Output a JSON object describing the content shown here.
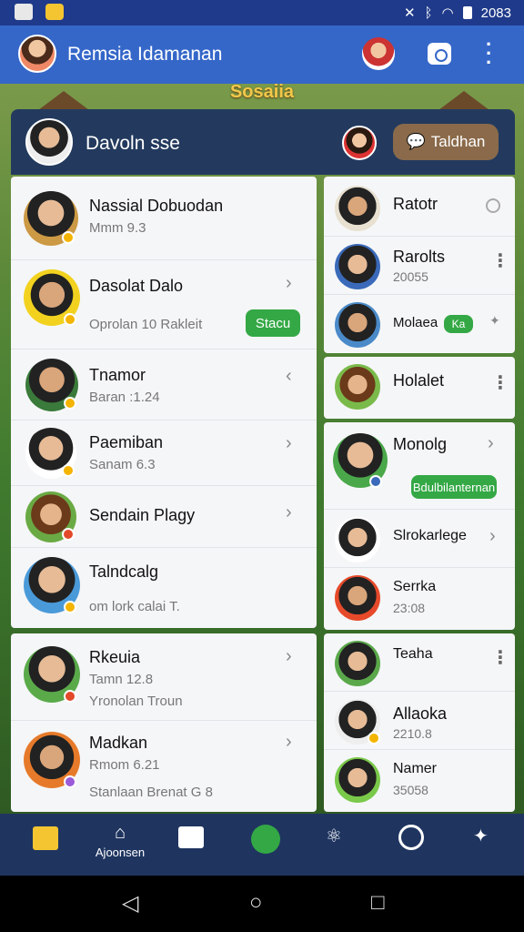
{
  "status_bar": {
    "time": "2083"
  },
  "app_bar": {
    "title": "Remsia Idamanan"
  },
  "background": {
    "title": "Sosaiia"
  },
  "panel": {
    "title": "Davoln sse",
    "action_button": "Taldhan"
  },
  "left_list": [
    {
      "name": "Nassial Dobuodan",
      "sub": "Mmm 9.3"
    },
    {
      "name": "Dasolat Dalo",
      "sub": "Oprolan 10 Rakleit",
      "action": "Stacu"
    },
    {
      "name": "Tnamor",
      "sub": "Baran :1.24"
    },
    {
      "name": "Paemiban",
      "sub": "Sanam 6.3"
    },
    {
      "name": "Sendain Plagy",
      "sub": ""
    },
    {
      "name": "Talndcalg",
      "sub": "om  lork   calai  T."
    },
    {
      "name": "Rkeuia",
      "sub": "Tamn 12.8",
      "sub2": "Yronolan Troun"
    },
    {
      "name": "Madkan",
      "sub": "Rmom 6.21",
      "sub2": "Stanlaan Brenat  G 8"
    }
  ],
  "right_list": [
    {
      "name": "Ratotr",
      "sub": ""
    },
    {
      "name": "Rarolts",
      "sub": "20055"
    },
    {
      "name": "Molaea",
      "sub": "",
      "tag": "Ka"
    },
    {
      "name": "Holalet",
      "sub": ""
    },
    {
      "name": "Monolg",
      "sub": "",
      "action": "Bdulbilanternan"
    },
    {
      "name": "Slrokarlege",
      "sub": ""
    },
    {
      "name": "Serrka",
      "sub": "23:08"
    },
    {
      "name": "Teaha",
      "sub": ""
    },
    {
      "name": "Allaoka",
      "sub": "2210.8"
    },
    {
      "name": "Namer",
      "sub": "35058"
    }
  ],
  "bottom_nav": {
    "label_2": "Ajoonsen"
  },
  "colors": {
    "app_bar": "#3567c9",
    "panel_header": "#233a5e",
    "accent_green": "#2e9a3a",
    "nav": "#1f3560"
  }
}
